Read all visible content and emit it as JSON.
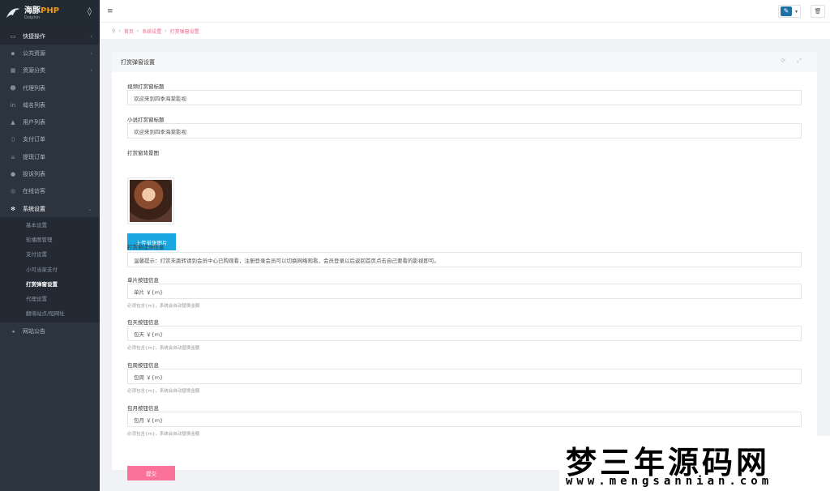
{
  "brand": {
    "name_main": "海豚",
    "name_accent": "PHP",
    "subtitle": "Dolphin",
    "drop_icon": "water-drop-icon"
  },
  "sidebar": {
    "items": [
      {
        "label": "快捷操作",
        "icon": "folder-open-icon",
        "caret": "‹"
      },
      {
        "label": "公共资源",
        "icon": "video-icon",
        "caret": "‹"
      },
      {
        "label": "资源分类",
        "icon": "grid-icon",
        "caret": "‹"
      },
      {
        "label": "代理列表",
        "icon": "users-icon"
      },
      {
        "label": "域名列表",
        "icon": "linkedin-icon"
      },
      {
        "label": "用户列表",
        "icon": "user-icon"
      },
      {
        "label": "支付订单",
        "icon": "file-icon"
      },
      {
        "label": "提现订单",
        "icon": "bank-icon"
      },
      {
        "label": "投诉列表",
        "icon": "info-icon"
      },
      {
        "label": "在线访客",
        "icon": "globe-icon"
      },
      {
        "label": "系统设置",
        "icon": "gear-icon",
        "caret": "⌄"
      }
    ],
    "subitems": [
      "基本设置",
      "轮播图管理",
      "支付设置",
      "小可当家支付",
      "打赏弹窗设置",
      "代理设置",
      "翻墙站点/短网址"
    ],
    "bottom_item": {
      "label": "网站公告",
      "icon": "bullhorn-icon"
    }
  },
  "header": {
    "menu_icon": "≡",
    "caret": "▾",
    "trash_icon": "🗑"
  },
  "breadcrumb": {
    "home_icon": "⚲",
    "items": [
      "首页",
      "系统设置",
      "打赏弹窗设置"
    ],
    "sep": "›"
  },
  "panel": {
    "title": "打赏弹窗设置",
    "tools": "⟳ ⤢",
    "fields": {
      "video_title_label": "视频打赏窗标题",
      "video_title_value": "欢迎来到四季海棠影视",
      "novel_title_label": "小说打赏窗标题",
      "novel_title_value": "欢迎来到四季海棠影视",
      "bg_image_label": "打赏窗背景图",
      "upload_label": "上传单张图片",
      "tip_label": "打赏窗提示信息",
      "tip_value": "温馨提示：打赏未跳转请到会员中心已购观看，注册登录会员可以切换网络观看，会员登录以后返回首页点击自己要看的影视即可。",
      "single_label": "单片按钮信息",
      "single_value": "单片 ￥{m}",
      "single_help": "必须包含{m}，系统会自动替换金额",
      "day_label": "包天按钮信息",
      "day_value": "包天 ￥{m}",
      "day_help": "必须包含{m}，系统会自动替换金额",
      "week_label": "包周按钮信息",
      "week_value": "包周 ￥{m}",
      "week_help": "必须包含{m}，系统会自动替换金额",
      "month_label": "包月按钮信息",
      "month_value": "包月 ￥{m}",
      "month_help": "必须包含{m}，系统会自动替换金额",
      "submit_label": "提交"
    }
  },
  "watermark": {
    "title": "梦三年源码网",
    "url": "www.mengsannian.com"
  },
  "colors": {
    "sidebar_bg": "#2c343f",
    "accent_pink": "#fb7299",
    "upload_blue": "#1aa7e0",
    "breadcrumb_link": "#e86a8c"
  }
}
